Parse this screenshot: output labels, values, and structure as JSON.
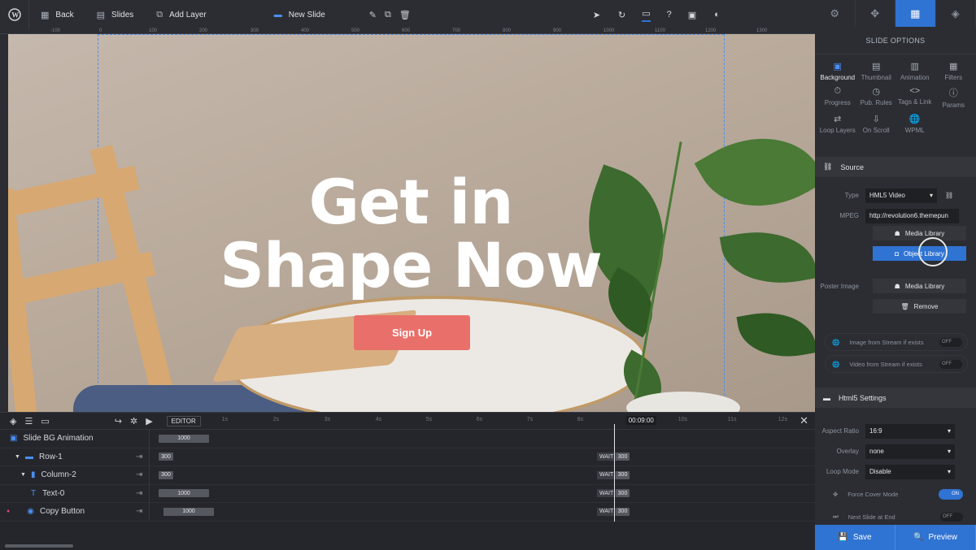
{
  "toolbar": {
    "back": "Back",
    "slides": "Slides",
    "add_layer": "Add Layer",
    "slide_name": "New Slide"
  },
  "ruler": [
    "-100",
    "0",
    "100",
    "200",
    "300",
    "400",
    "500",
    "600",
    "700",
    "800",
    "900",
    "1000",
    "1100",
    "1200",
    "1300"
  ],
  "slide": {
    "heading_line1": "Get in",
    "heading_line2": "Shape Now",
    "button": "Sign Up"
  },
  "timeline": {
    "mode": "EDITOR",
    "ticks": [
      "1s",
      "2s",
      "3s",
      "4s",
      "5s",
      "6s",
      "7s",
      "8s",
      "9s",
      "10s",
      "11s",
      "12s"
    ],
    "current_time": "00:09:00",
    "layers": [
      {
        "name": "Slide BG Animation",
        "bar": "1000",
        "wait": "",
        "end": ""
      },
      {
        "name": "Row-1",
        "bar": "300",
        "wait": "WAIT",
        "end": "300"
      },
      {
        "name": "Column-2",
        "bar": "300",
        "wait": "WAIT",
        "end": "300"
      },
      {
        "name": "Text-0",
        "bar": "1000",
        "wait": "WAIT",
        "end": "300"
      },
      {
        "name": "Copy Button",
        "bar": "1000",
        "wait": "WAIT",
        "end": "300"
      }
    ]
  },
  "panel": {
    "title": "SLIDE OPTIONS",
    "options": [
      "Background",
      "Thumbnail",
      "Animation",
      "Filters",
      "Progress",
      "Pub. Rules",
      "Tags & Link",
      "Params",
      "Loop Layers",
      "On Scroll",
      "WPML"
    ],
    "source": {
      "header": "Source",
      "type_label": "Type",
      "type_value": "HML5 Video",
      "mpeg_label": "MPEG",
      "mpeg_value": "http://revolution6.themepun",
      "media_library": "Media Library",
      "object_library": "Object Library",
      "poster_label": "Poster Image",
      "poster_media": "Media Library",
      "remove": "Remove",
      "image_stream": "Image from Stream if exists",
      "video_stream": "Video from Stream if exists",
      "off": "OFF"
    },
    "html5": {
      "header": "Html5 Settings",
      "aspect_label": "Aspect Ratio",
      "aspect_value": "16:9",
      "overlay_label": "Overlay",
      "overlay_value": "none",
      "loop_label": "Loop Mode",
      "loop_value": "Disable",
      "force_cover": "Force Cover Mode",
      "force_on": "ON",
      "next_slide": "Next Slide at End",
      "next_off": "OFF"
    },
    "save": "Save",
    "preview": "Preview"
  },
  "colors": {
    "accent": "#2f73d3",
    "button": "#e9706a"
  }
}
